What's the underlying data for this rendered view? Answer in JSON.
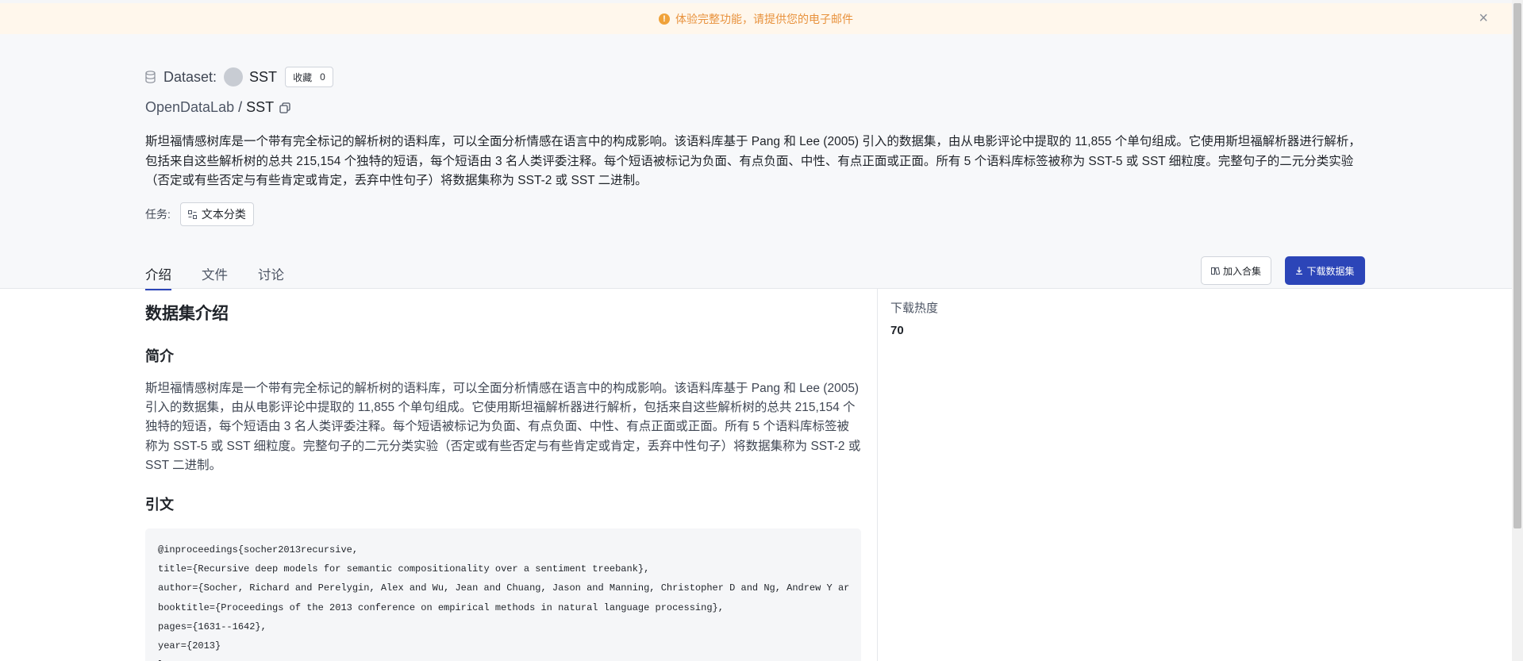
{
  "notice": {
    "text": "体验完整功能，请提供您的电子邮件"
  },
  "header": {
    "dataset_label": "Dataset:",
    "dataset_name": "SST",
    "fav_label": "收藏",
    "fav_count": "0",
    "org": "OpenDataLab",
    "path_sep": "/",
    "path_name": "SST",
    "description": "斯坦福情感树库是一个带有完全标记的解析树的语料库，可以全面分析情感在语言中的构成影响。该语料库基于 Pang 和 Lee (2005) 引入的数据集，由从电影评论中提取的 11,855 个单句组成。它使用斯坦福解析器进行解析，包括来自这些解析树的总共 215,154 个独特的短语，每个短语由 3 名人类评委注释。每个短语被标记为负面、有点负面、中性、有点正面或正面。所有 5 个语料库标签被称为 SST-5 或 SST 细粒度。完整句子的二元分类实验（否定或有些否定与有些肯定或肯定，丢弃中性句子）将数据集称为 SST-2 或 SST 二进制。",
    "task_label": "任务:",
    "task_value": "文本分类"
  },
  "tabs": [
    {
      "label": "介绍"
    },
    {
      "label": "文件"
    },
    {
      "label": "讨论"
    }
  ],
  "actions": {
    "add_label": "加入合集",
    "download_label": "下载数据集"
  },
  "main": {
    "title": "数据集介绍",
    "intro_heading": "简介",
    "intro_text": "斯坦福情感树库是一个带有完全标记的解析树的语料库，可以全面分析情感在语言中的构成影响。该语料库基于 Pang 和 Lee (2005) 引入的数据集，由从电影评论中提取的 11,855 个单句组成。它使用斯坦福解析器进行解析，包括来自这些解析树的总共 215,154 个独特的短语，每个短语由 3 名人类评委注释。每个短语被标记为负面、有点负面、中性、有点正面或正面。所有 5 个语料库标签被称为 SST-5 或 SST 细粒度。完整句子的二元分类实验（否定或有些否定与有些肯定或肯定，丢弃中性句子）将数据集称为 SST-2 或 SST 二进制。",
    "citation_heading": "引文",
    "citation_code": "@inproceedings{socher2013recursive,\ntitle={Recursive deep models for semantic compositionality over a sentiment treebank},\nauthor={Socher, Richard and Perelygin, Alex and Wu, Jean and Chuang, Jason and Manning, Christopher D and Ng, Andrew Y ar\nbooktitle={Proceedings of the 2013 conference on empirical methods in natural language processing},\npages={1631--1642},\nyear={2013}\n}"
  },
  "side": {
    "downloads_label": "下载热度",
    "downloads_value": "70"
  },
  "colors": {
    "accent": "#2c45b8",
    "notice_bg": "#fff7ec",
    "notice_text": "#e8923d"
  }
}
